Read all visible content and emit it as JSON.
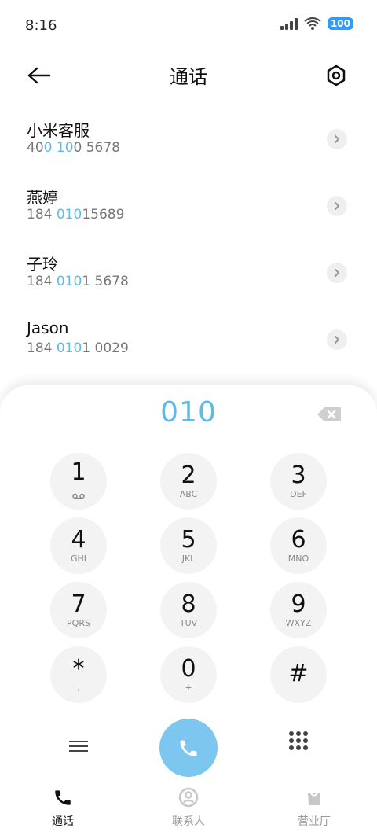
{
  "status_bar": {
    "time": "8:16",
    "battery": "100"
  },
  "header": {
    "title": "通话"
  },
  "contacts": [
    {
      "name": "小米客服",
      "number_prefix": "40",
      "number_hl1": "0",
      "number_mid": " ",
      "number_hl2": "10",
      "number_suffix": "0 5678"
    },
    {
      "name": "燕婷",
      "number_prefix": "184 ",
      "number_hl1": "010",
      "number_mid": "",
      "number_hl2": "",
      "number_suffix": "15689"
    },
    {
      "name": "子玲",
      "number_prefix": "184 ",
      "number_hl1": "010",
      "number_mid": "",
      "number_hl2": "",
      "number_suffix": "1 5678"
    },
    {
      "name": "Jason",
      "number_prefix": "184 ",
      "number_hl1": "010",
      "number_mid": "",
      "number_hl2": "",
      "number_suffix": "1 0029"
    }
  ],
  "dialer": {
    "input_value": "010",
    "keys": [
      {
        "digit": "1",
        "sub": ""
      },
      {
        "digit": "2",
        "sub": "ABC"
      },
      {
        "digit": "3",
        "sub": "DEF"
      },
      {
        "digit": "4",
        "sub": "GHI"
      },
      {
        "digit": "5",
        "sub": "JKL"
      },
      {
        "digit": "6",
        "sub": "MNO"
      },
      {
        "digit": "7",
        "sub": "PQRS"
      },
      {
        "digit": "8",
        "sub": "TUV"
      },
      {
        "digit": "9",
        "sub": "WXYZ"
      },
      {
        "digit": "*",
        "sub": ","
      },
      {
        "digit": "0",
        "sub": "+"
      },
      {
        "digit": "#",
        "sub": ""
      }
    ]
  },
  "bottom_nav": [
    {
      "label": "通话",
      "icon": "phone-icon",
      "active": true
    },
    {
      "label": "联系人",
      "icon": "person-icon",
      "active": false
    },
    {
      "label": "营业厅",
      "icon": "shopping-bag-icon",
      "active": false
    }
  ],
  "colors": {
    "accent": "#5dbbea",
    "call_button": "#7cc6f0",
    "battery": "#2f9cf5"
  }
}
